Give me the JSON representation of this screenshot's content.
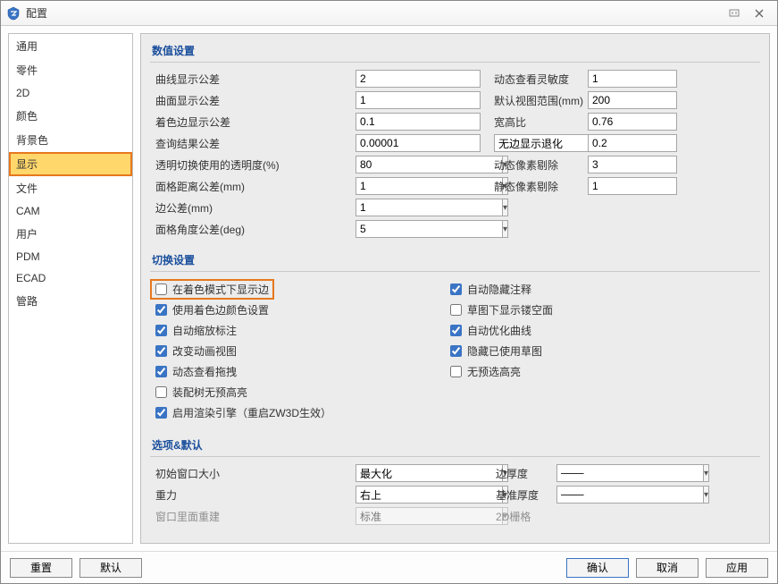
{
  "window": {
    "title": "配置"
  },
  "sidebar": {
    "items": [
      {
        "label": "通用"
      },
      {
        "label": "零件"
      },
      {
        "label": "2D"
      },
      {
        "label": "颜色"
      },
      {
        "label": "背景色"
      },
      {
        "label": "显示",
        "selected": true
      },
      {
        "label": "文件"
      },
      {
        "label": "CAM"
      },
      {
        "label": "用户"
      },
      {
        "label": "PDM"
      },
      {
        "label": "ECAD"
      },
      {
        "label": "管路"
      }
    ]
  },
  "sections": {
    "numeric": {
      "title": "数值设置",
      "rows": {
        "curveTol": {
          "label": "曲线显示公差",
          "value": "2",
          "label2": "动态查看灵敏度",
          "value2": "1"
        },
        "surfaceTol": {
          "label": "曲面显示公差",
          "value": "1",
          "label2": "默认视图范围(mm)",
          "value2": "200"
        },
        "shadeEdgeTol": {
          "label": "着色边显示公差",
          "value": "0.1",
          "label2": "宽高比",
          "value2": "0.76"
        },
        "queryTol": {
          "label": "查询结果公差",
          "value": "0.00001",
          "label2": "无边显示退化",
          "value2": "0.2",
          "dropdown": true
        },
        "transparency": {
          "label": "透明切换使用的透明度(%)",
          "value": "80",
          "label2": "动态像素剔除",
          "value2": "3"
        },
        "gridDist": {
          "label": "面格距离公差(mm)",
          "value": "1",
          "label2": "静态像素剔除",
          "value2": "1"
        },
        "edgeTol": {
          "label": "边公差(mm)",
          "value": "1"
        },
        "gridAngle": {
          "label": "面格角度公差(deg)",
          "value": "5"
        }
      }
    },
    "toggle": {
      "title": "切换设置",
      "left": [
        {
          "label": "在着色模式下显示边",
          "checked": false,
          "highlight": true
        },
        {
          "label": "使用着色边颜色设置",
          "checked": true
        },
        {
          "label": "自动缩放标注",
          "checked": true
        },
        {
          "label": "改变动画视图",
          "checked": true
        },
        {
          "label": "动态查看拖拽",
          "checked": true
        },
        {
          "label": "装配树无预高亮",
          "checked": false
        },
        {
          "label": "启用渲染引擎（重启ZW3D生效）",
          "checked": true
        }
      ],
      "right": [
        {
          "label": "自动隐藏注释",
          "checked": true
        },
        {
          "label": "草图下显示镂空面",
          "checked": false
        },
        {
          "label": "自动优化曲线",
          "checked": true
        },
        {
          "label": "隐藏已使用草图",
          "checked": true
        },
        {
          "label": "无预选高亮",
          "checked": false
        }
      ]
    },
    "options": {
      "title": "选项&默认",
      "rows": {
        "winSize": {
          "label": "初始窗口大小",
          "value": "最大化",
          "label2": "边厚度"
        },
        "gravity": {
          "label": "重力",
          "value": "右上",
          "label2": "基准厚度"
        },
        "rebuild": {
          "label": "窗口里面重建",
          "value": "标准",
          "label2": "2D栅格"
        }
      }
    }
  },
  "footer": {
    "reset": "重置",
    "default": "默认",
    "ok": "确认",
    "cancel": "取消",
    "apply": "应用"
  }
}
